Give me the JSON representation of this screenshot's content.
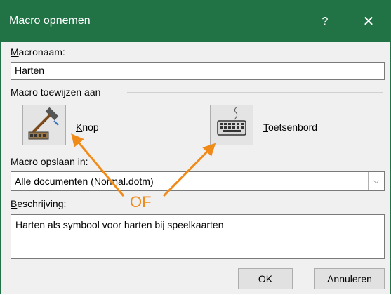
{
  "title": "Macro opnemen",
  "help_label": "?",
  "close_label": "✕",
  "macro_name_label": {
    "accel": "M",
    "rest": "acronaam:"
  },
  "macro_name_value": "Harten",
  "assign_label": "Macro toewijzen aan",
  "button_option": {
    "accel": "K",
    "rest": "nop"
  },
  "keyboard_option": {
    "accel": "T",
    "rest": "oetsenbord"
  },
  "store_label": {
    "pre": "Macro ",
    "accel": "o",
    "rest": "pslaan in:"
  },
  "store_value": "Alle documenten (Normal.dotm)",
  "description_label": {
    "accel": "B",
    "rest": "eschrijving:"
  },
  "description_value": "Harten als symbool voor harten bij speelkaarten",
  "ok_label": "OK",
  "cancel_label": "Annuleren",
  "annotation_text": "OF",
  "colors": {
    "titlebar": "#217346",
    "annotation": "#f08a19"
  },
  "icons": [
    "hammer-icon",
    "keyboard-icon",
    "chevron-down-icon"
  ]
}
